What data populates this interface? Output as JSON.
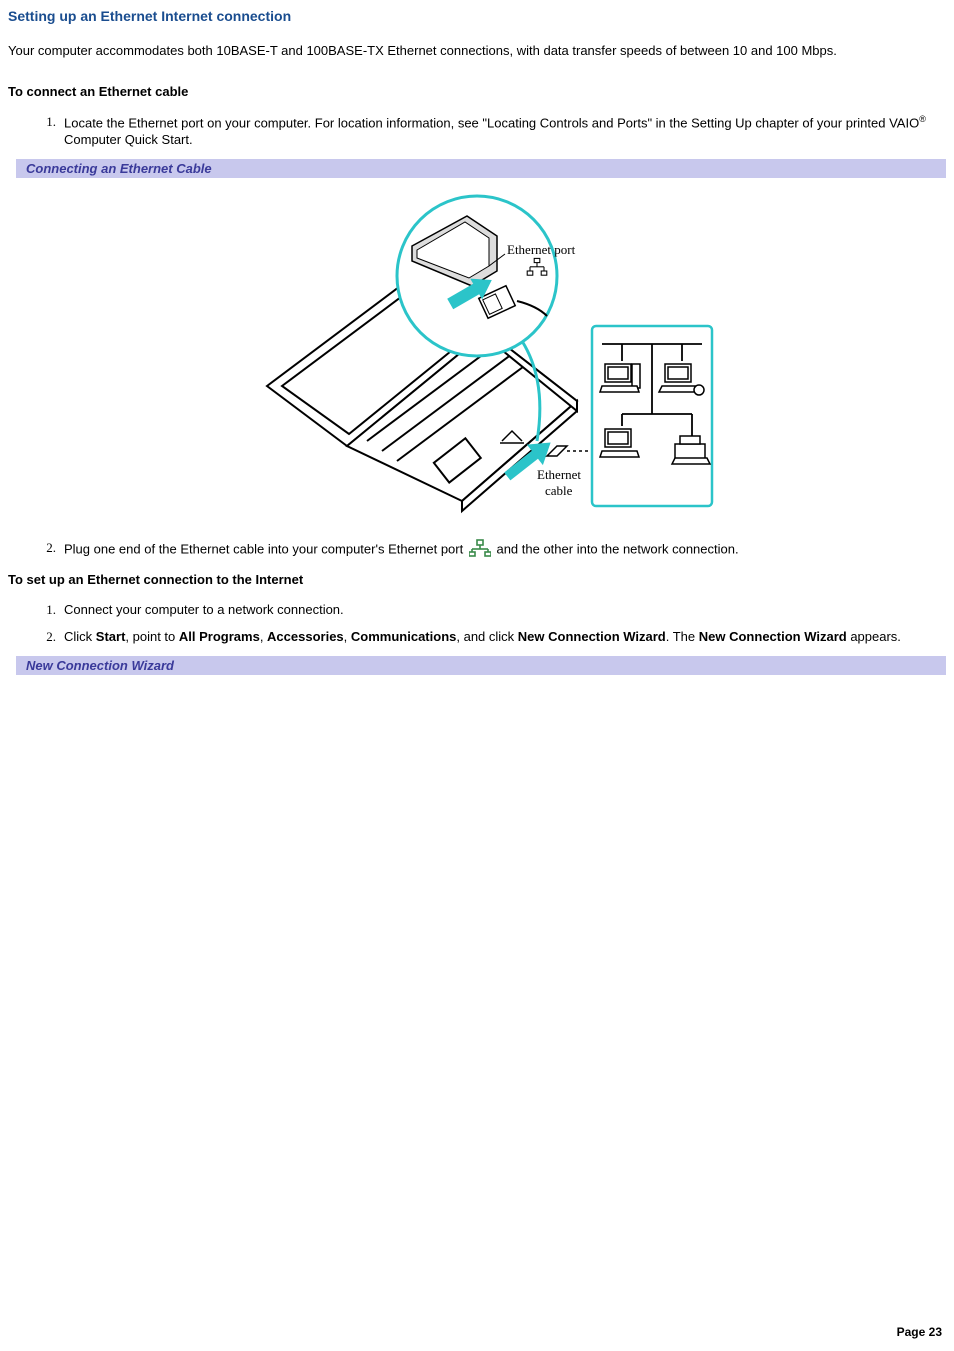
{
  "title": "Setting up an Ethernet Internet connection",
  "intro": "Your computer accommodates both 10BASE-T and 100BASE-TX Ethernet connections, with data transfer speeds of between 10 and 100 Mbps.",
  "section1": {
    "heading": "To connect an Ethernet cable",
    "step1_a": "Locate the Ethernet port on your computer. For location information, see \"Locating Controls and Ports\" in the Setting Up chapter of your printed VAIO",
    "step1_trademark": "®",
    "step1_b": " Computer Quick Start.",
    "caption": "Connecting an Ethernet Cable",
    "figure": {
      "label_port": "Ethernet port",
      "label_cable": "Ethernet cable"
    },
    "step2_a": "Plug one end of the Ethernet cable into your computer's Ethernet port ",
    "step2_b": "and the other into the network connection."
  },
  "section2": {
    "heading": "To set up an Ethernet connection to the Internet",
    "step1": "Connect your computer to a network connection.",
    "step2": {
      "pre": "Click ",
      "b1": "Start",
      "t1": ", point to ",
      "b2": "All Programs",
      "t2": ", ",
      "b3": "Accessories",
      "t3": ", ",
      "b4": "Communications",
      "t4": ", and click ",
      "b5": "New Connection Wizard",
      "t5": ". The ",
      "b6": "New Connection Wizard",
      "t6": " appears."
    },
    "caption": "New Connection Wizard"
  },
  "pageNumber": "Page 23",
  "listNumbers": {
    "n1": "1.",
    "n2": "2."
  }
}
